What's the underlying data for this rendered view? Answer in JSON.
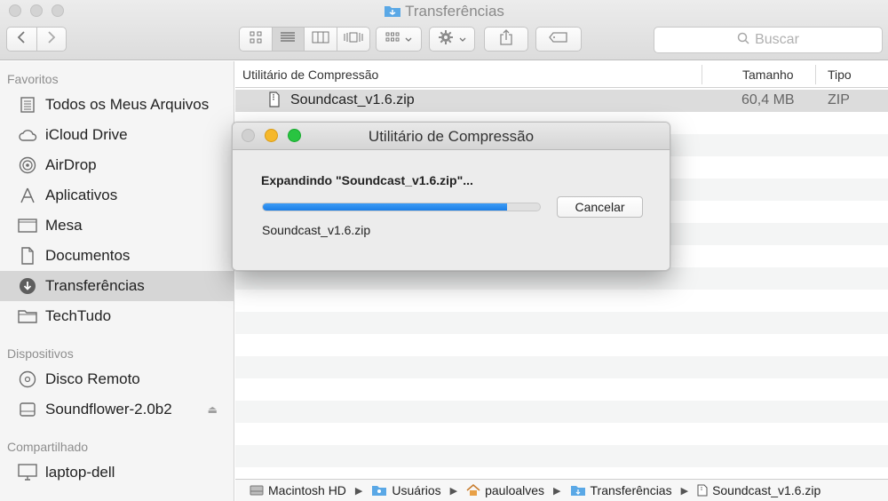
{
  "window": {
    "title": "Transferências"
  },
  "toolbar": {
    "search_placeholder": "Buscar"
  },
  "sidebar": {
    "sections": [
      {
        "header": "Favoritos",
        "items": [
          {
            "label": "Todos os Meus Arquivos",
            "icon": "all-files-icon"
          },
          {
            "label": "iCloud Drive",
            "icon": "cloud-icon"
          },
          {
            "label": "AirDrop",
            "icon": "airdrop-icon"
          },
          {
            "label": "Aplicativos",
            "icon": "applications-icon"
          },
          {
            "label": "Mesa",
            "icon": "desktop-icon"
          },
          {
            "label": "Documentos",
            "icon": "document-icon"
          },
          {
            "label": "Transferências",
            "icon": "download-icon",
            "selected": true
          },
          {
            "label": "TechTudo",
            "icon": "folder-icon"
          }
        ]
      },
      {
        "header": "Dispositivos",
        "items": [
          {
            "label": "Disco Remoto",
            "icon": "disc-icon"
          },
          {
            "label": "Soundflower-2.0b2",
            "icon": "drive-icon",
            "eject": true
          }
        ]
      },
      {
        "header": "Compartilhado",
        "items": [
          {
            "label": "laptop-dell",
            "icon": "computer-icon"
          }
        ]
      }
    ]
  },
  "list": {
    "columns": {
      "name": "Utilitário de Compressão",
      "size": "Tamanho",
      "kind": "Tipo"
    },
    "rows": [
      {
        "name": "Soundcast_v1.6.zip",
        "size": "60,4 MB",
        "kind": "ZIP",
        "selected": true
      }
    ]
  },
  "pathbar": {
    "items": [
      "Macintosh HD",
      "Usuários",
      "pauloalves",
      "Transferências",
      "Soundcast_v1.6.zip"
    ]
  },
  "dialog": {
    "title": "Utilitário de Compressão",
    "message": "Expandindo \"Soundcast_v1.6.zip\"...",
    "progress_fraction": 0.88,
    "filename": "Soundcast_v1.6.zip",
    "cancel_label": "Cancelar"
  },
  "colors": {
    "progress": "#1c7ee7",
    "close": "#d0d0d0",
    "minimize": "#f5b82b",
    "zoom": "#29c441",
    "folder": "#5aa8e6"
  }
}
